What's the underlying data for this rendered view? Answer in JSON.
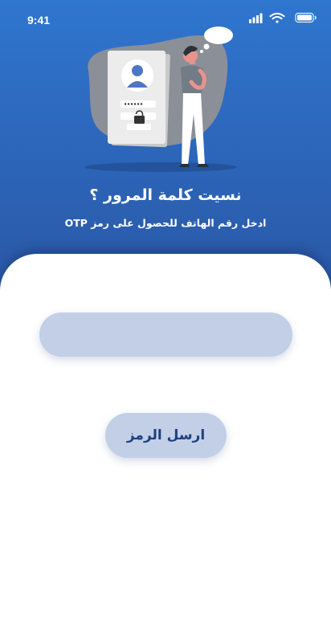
{
  "status_bar": {
    "time": "9:41",
    "icons": [
      "signal-icon",
      "wifi-icon",
      "battery-icon"
    ]
  },
  "header": {
    "title": "نسيت كلمة المرور ؟",
    "subtitle": "ادخل رقم الهاتف للحصول على رمز OTP"
  },
  "form": {
    "phone_value": "",
    "phone_placeholder": "",
    "send_label": "ارسل الرمز"
  },
  "colors": {
    "hero_top": "#2f76cf",
    "hero_bottom": "#2a58a6",
    "field_background": "#c2cfe7",
    "button_text": "#1d3f80"
  }
}
